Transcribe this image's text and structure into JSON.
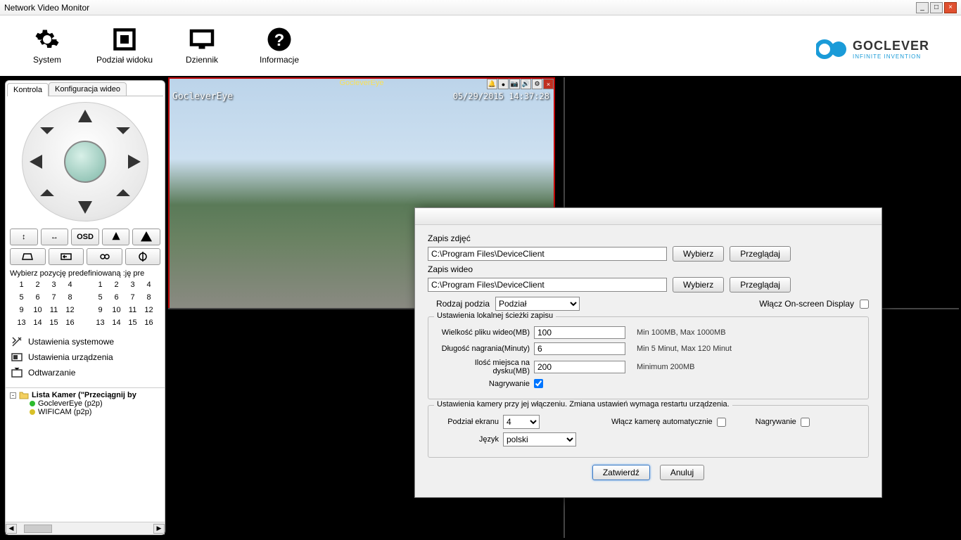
{
  "window": {
    "title": "Network Video Monitor"
  },
  "logo": {
    "brand": "GOCLEVER",
    "tagline": "INFINITE INVENTION"
  },
  "toolbar": {
    "system": "System",
    "view_split": "Podział widoku",
    "log": "Dziennik",
    "info": "Informacje"
  },
  "sidebar": {
    "tabs": {
      "control": "Kontrola",
      "video_config": "Konfiguracja wideo"
    },
    "osd_btn": "OSD",
    "preset_caption": "Wybierz pozycję predefiniowaną :ję pre",
    "presets": [
      "1",
      "2",
      "3",
      "4",
      "5",
      "6",
      "7",
      "8",
      "9",
      "10",
      "11",
      "12",
      "13",
      "14",
      "15",
      "16"
    ],
    "settings": {
      "system": "Ustawienia systemowe",
      "device": "Ustawienia urządzenia",
      "playback": "Odtwarzanie"
    },
    "cameras": {
      "folder": "Lista Kamer (\"Przeciągnij by",
      "cam1": "GocleverEye (p2p)",
      "cam2": "WIFICAM (p2p)"
    }
  },
  "camtile": {
    "title": "GocleverEye",
    "overlay_name": "GocleverEye",
    "overlay_time": "05/29/2015 14:37:28"
  },
  "modal": {
    "photo_label": "Zapis zdjęć",
    "photo_path": "C:\\Program Files\\DeviceClient",
    "video_label": "Zapis wideo",
    "video_path": "C:\\Program Files\\DeviceClient",
    "select_btn": "Wybierz",
    "browse_btn": "Przeglądaj",
    "split_type_label": "Rodzaj podzia",
    "split_type_value": "Podział",
    "osd_label": "Włącz On-screen Display",
    "group_local": "Ustawienia lokalnej ścieżki zapisu",
    "filesize_label": "Wielkość pliku wideo(MB)",
    "filesize_value": "100",
    "filesize_hint": "Min 100MB, Max 1000MB",
    "duration_label": "Długość nagrania(Minuty)",
    "duration_value": "6",
    "duration_hint": "Min 5 Minut, Max 120 Minut",
    "disk_label": "Ilość miejsca na dysku(MB)",
    "disk_value": "200",
    "disk_hint": "Minimum 200MB",
    "recording_label": "Nagrywanie",
    "group_camera": "Ustawienia kamery przy jej włączeniu. Zmiana ustawień wymaga restartu urządzenia.",
    "screen_split_label": "Podział ekranu",
    "screen_split_value": "4",
    "auto_on_label": "Włącz kamerę automatycznie",
    "recording2_label": "Nagrywanie",
    "language_label": "Język",
    "language_value": "polski",
    "confirm_btn": "Zatwierdź",
    "cancel_btn": "Anuluj"
  }
}
